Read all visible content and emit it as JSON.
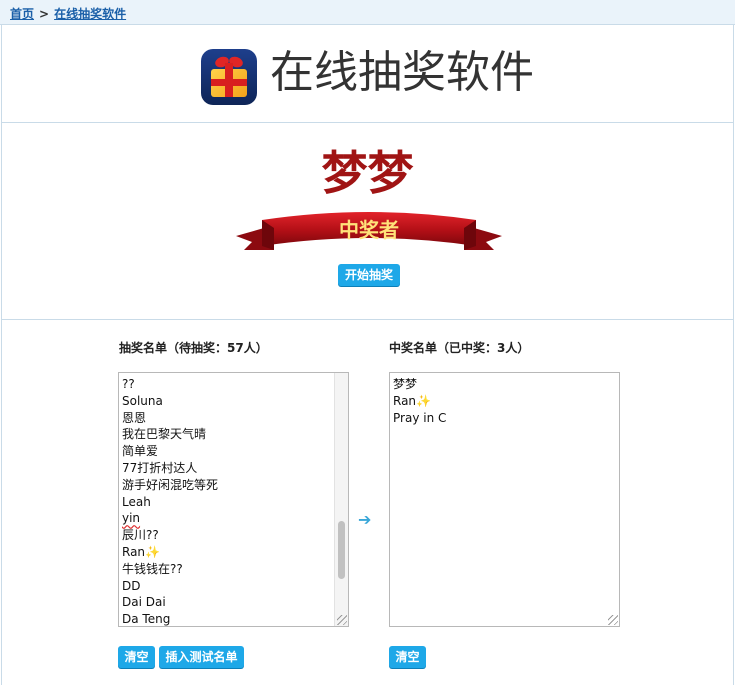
{
  "breadcrumb": {
    "home": "首页",
    "separator": ">",
    "current": "在线抽奖软件"
  },
  "header": {
    "title": "在线抽奖软件",
    "icon": "gift-icon"
  },
  "winner": {
    "name": "梦梦",
    "banner_text": "中奖者",
    "start_button": "开始抽奖"
  },
  "pool": {
    "label": "抽奖名单（待抽奖：57人）",
    "entries": [
      "??",
      "Soluna",
      "恩恩",
      "我在巴黎天气晴",
      "简单爱",
      "77打折村达人",
      "游手好闲混吃等死",
      "Leah",
      "yin",
      "辰川??",
      "Ran✨",
      "牛钱钱在??",
      "DD",
      "Dai Dai",
      "Da Teng"
    ],
    "clear_button": "清空",
    "insert_button": "插入测试名单"
  },
  "winners": {
    "label": "中奖名单（已中奖：3人）",
    "entries": [
      "梦梦",
      "Ran✨",
      "Pray in C"
    ],
    "clear_button": "清空"
  },
  "colors": {
    "accent": "#1ea8e8",
    "winner_name": "#a01414",
    "banner_red": "#c8141a",
    "banner_text": "#ffe27a"
  }
}
